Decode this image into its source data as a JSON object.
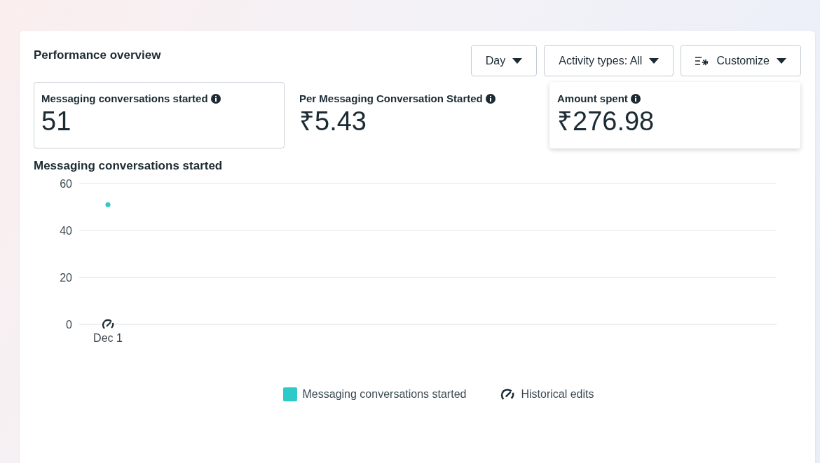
{
  "panel": {
    "title": "Performance overview"
  },
  "controls": [
    {
      "kind": "dropdown",
      "label": "Day"
    },
    {
      "kind": "dropdown",
      "label": "Activity types: All"
    },
    {
      "kind": "customize",
      "label": "Customize"
    }
  ],
  "metrics": [
    {
      "label": "Messaging conversations started",
      "value": "51",
      "selected": true,
      "raised": false
    },
    {
      "label": "Per Messaging Conversation Started",
      "value": "₹5.43",
      "selected": false,
      "raised": false
    },
    {
      "label": "Amount spent",
      "value": "₹276.98",
      "selected": false,
      "raised": true
    }
  ],
  "chart": {
    "title": "Messaging conversations started",
    "chart_data": {
      "type": "line",
      "categories": [
        "Dec 1"
      ],
      "series": [
        {
          "name": "Messaging conversations started",
          "color": "#2ec9c9",
          "marker": true,
          "values": [
            51
          ]
        }
      ],
      "ylim": [
        0,
        60
      ],
      "yticks": [
        0,
        20,
        40,
        60
      ]
    },
    "legend": [
      {
        "kind": "series"
      },
      {
        "kind": "edits",
        "label": "Historical edits"
      }
    ]
  }
}
